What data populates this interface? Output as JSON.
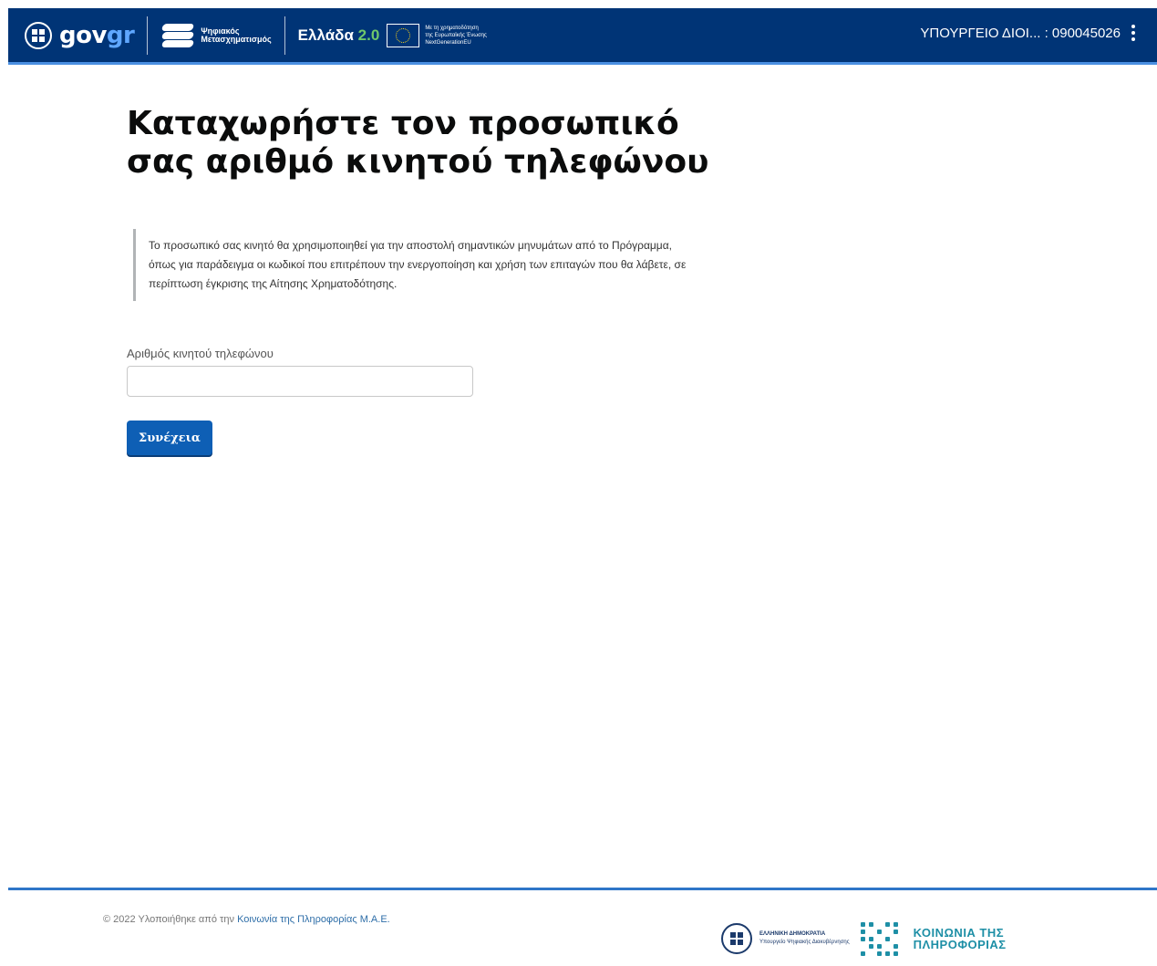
{
  "header": {
    "govgr_prefix": "gov",
    "govgr_suffix": "gr",
    "digital_line1": "Ψηφιακός",
    "digital_line2": "Μετασχηματισμός",
    "ellada_text": "Ελλάδα",
    "ellada_version": "2.0",
    "eu_line1": "Με τη χρηματοδότηση",
    "eu_line2": "της Ευρωπαϊκής Ένωσης",
    "eu_line3": "NextGenerationEU",
    "user_label": "ΥΠΟΥΡΓΕΙΟ ΔΙΟΙ... : 090045026"
  },
  "main": {
    "title_line1": "Καταχωρήστε τον προσωπικό",
    "title_line2": "σας αριθμό κινητού τηλεφώνου",
    "info_text": "Το προσωπικό σας κινητό θα χρησιμοποιηθεί για την αποστολή σημαντικών μηνυμάτων από το Πρόγραμμα, όπως για παράδειγμα οι κωδικοί που επιτρέπουν την ενεργοποίηση και χρήση των επιταγών που θα λάβετε, σε περίπτωση έγκρισης της Αίτησης Χρηματοδότησης.",
    "phone_label": "Αριθμός κινητού τηλεφώνου",
    "phone_value": "",
    "continue_label": "Συνέχεια"
  },
  "footer": {
    "copyright_prefix": "© 2022 Υλοποιήθηκε από την",
    "copyright_link": "Κοινωνία της Πληροφορίας Μ.Α.Ε.",
    "ministry_line1": "ΕΛΛΗΝΙΚΗ ΔΗΜΟΚΡΑΤΙΑ",
    "ministry_line2": "Υπουργείο Ψηφιακής Διακυβέρνησης",
    "ktp_line1": "ΚΟΙΝΩΝΙΑ ΤΗΣ",
    "ktp_line2": "ΠΛΗΡΟΦΟΡΙΑΣ"
  },
  "colors": {
    "header_bg": "#003476",
    "primary_button": "#0e5fb5",
    "footer_border": "#2f76c8"
  }
}
